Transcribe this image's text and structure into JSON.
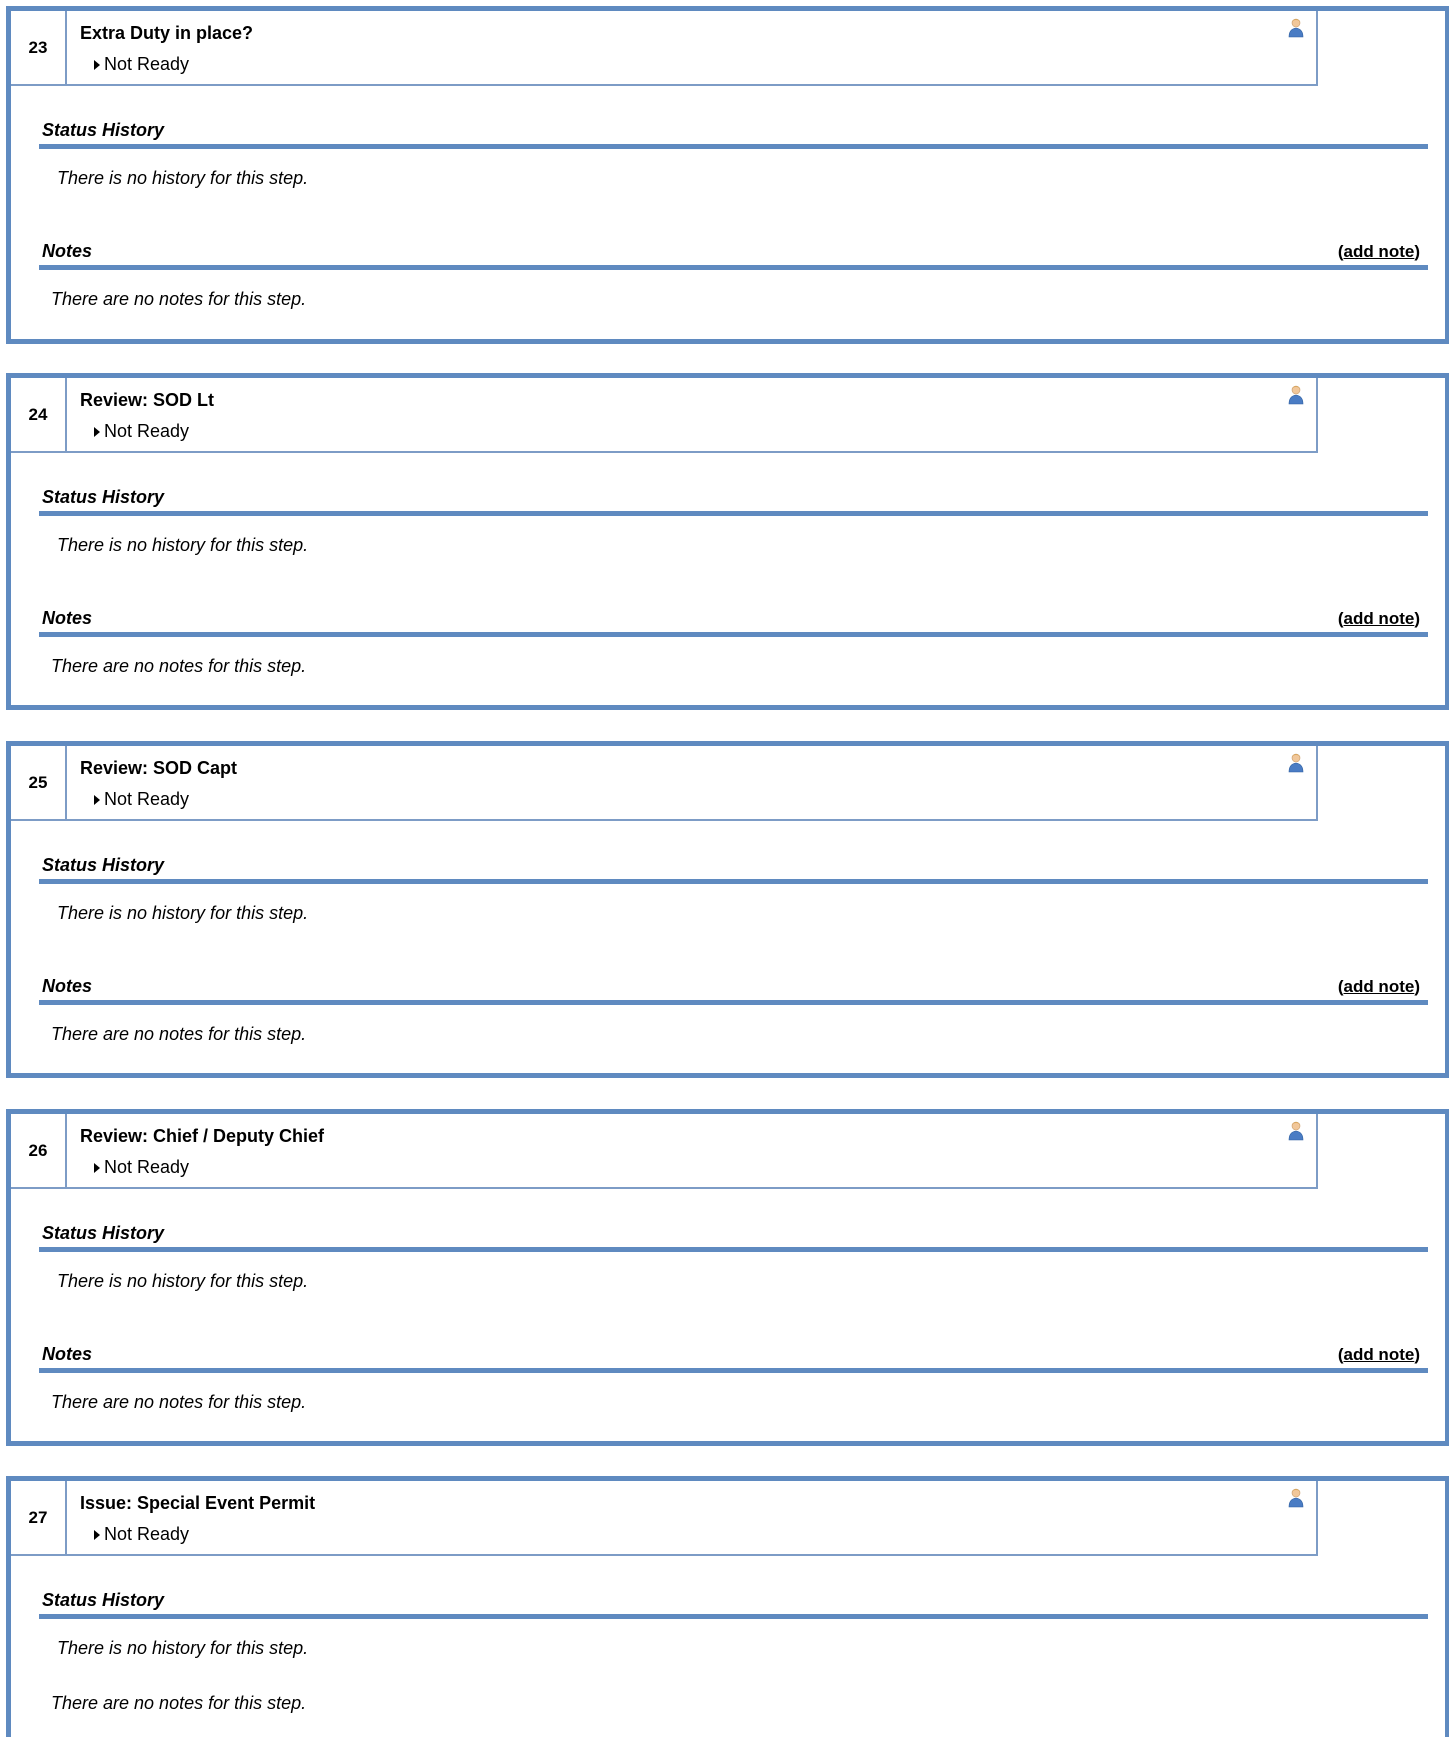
{
  "labels": {
    "status_history": "Status History",
    "notes": "Notes",
    "add_note_open": "(",
    "add_note_link": "add note",
    "add_note_close": ")",
    "no_history": "There is no history for this step.",
    "no_notes": "There are no notes for this step."
  },
  "steps": [
    {
      "number": "23",
      "title": "Extra Duty in place?",
      "status": "Not Ready"
    },
    {
      "number": "24",
      "title": "Review: SOD Lt",
      "status": "Not Ready"
    },
    {
      "number": "25",
      "title": "Review: SOD Capt",
      "status": "Not Ready"
    },
    {
      "number": "26",
      "title": "Review: Chief / Deputy Chief",
      "status": "Not Ready"
    },
    {
      "number": "27",
      "title": "Issue: Special Event Permit",
      "status": "Not Ready"
    }
  ],
  "icons": {
    "assignee": "user-icon",
    "status_arrow": "caret-right-icon"
  },
  "colors": {
    "border": "#5f8ac0",
    "header_border": "#7d9cc6"
  }
}
